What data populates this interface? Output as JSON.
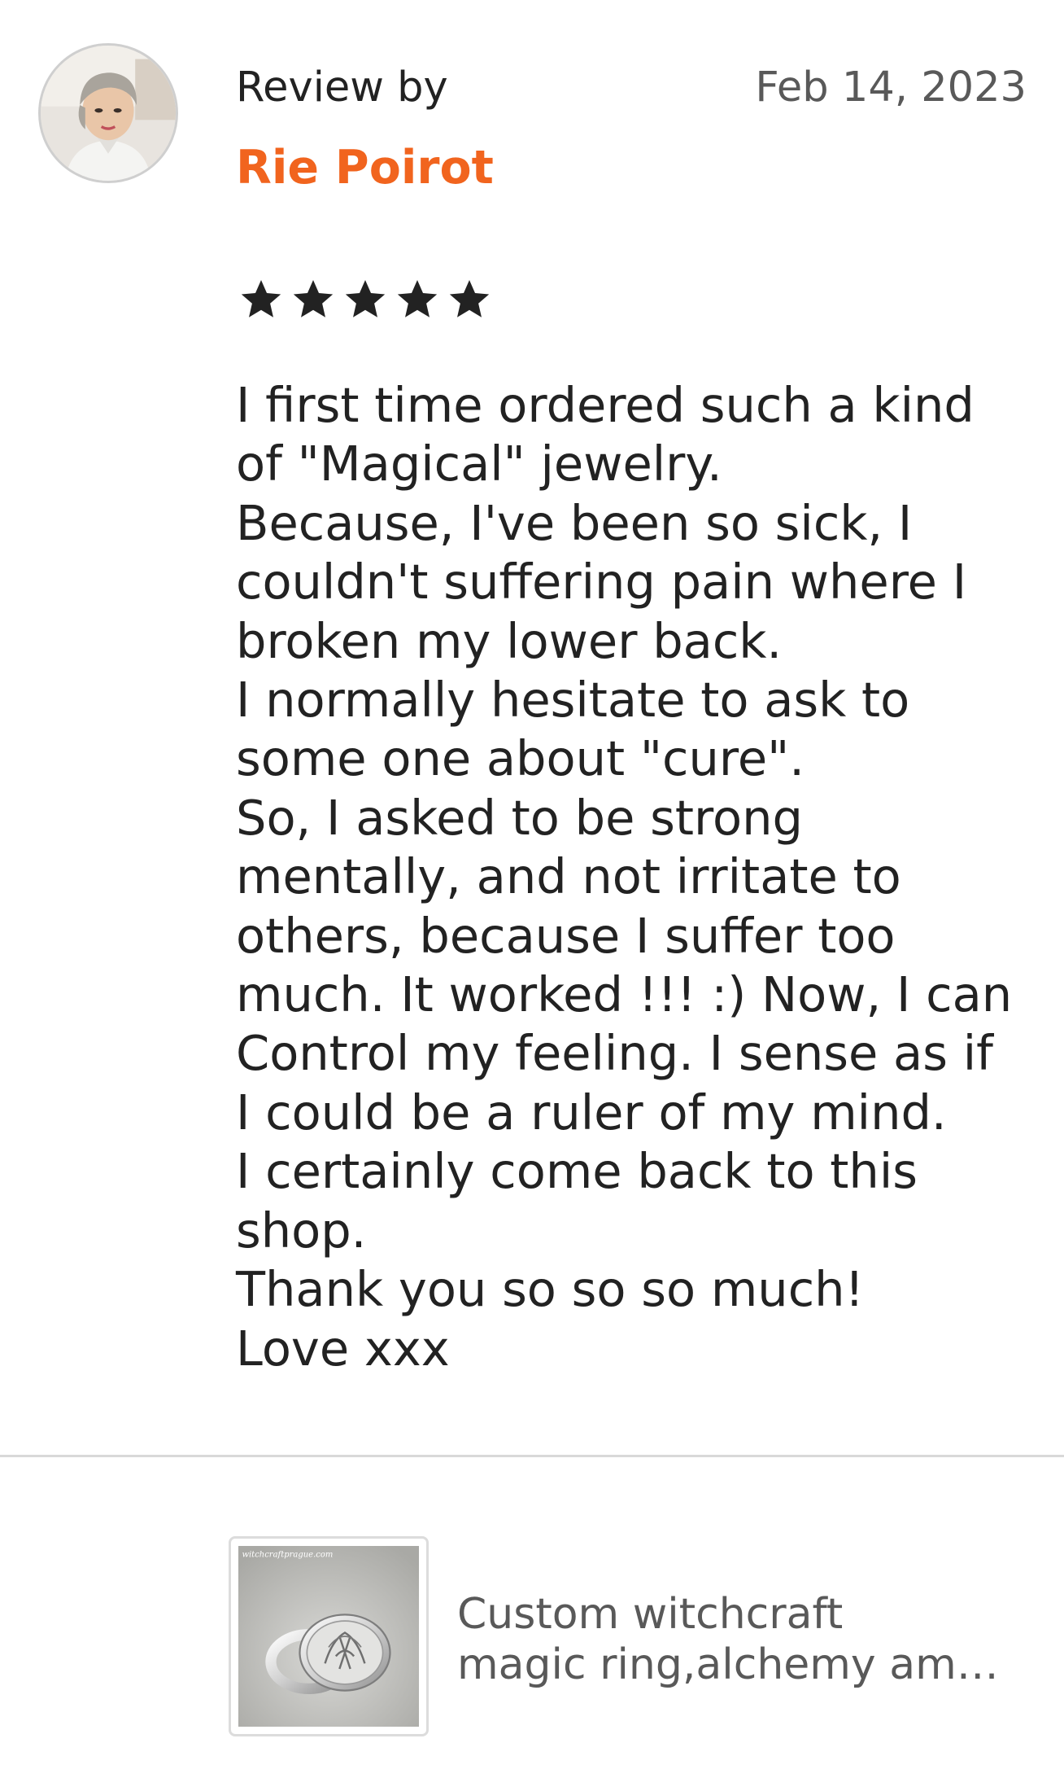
{
  "review": {
    "avatar_icon": "reviewer-avatar",
    "review_by_label": "Review by",
    "date": "Feb 14, 2023",
    "reviewer_name": "Rie Poirot",
    "rating": 5,
    "rating_max": 5,
    "star_icon": "star-icon",
    "text_lines": [
      "I first time ordered such a kind",
      "of \"Magical\" jewelry.",
      "Because, I've been so sick, I",
      "couldn't suffering pain where I",
      "broken my lower back.",
      "I normally hesitate to ask to",
      "some one about \"cure\".",
      "So, I asked to be strong",
      "mentally, and not irritate to",
      "others, because I suffer too",
      "much. It worked !!! :) Now, I can",
      "Control my feeling. I sense as if",
      "I could be a ruler of my mind.",
      "I certainly come back to this",
      "shop.",
      "Thank you so so so much!",
      "Love xxx"
    ]
  },
  "product": {
    "thumbnail_watermark": "witchcraftprague.com",
    "title_lines": [
      "Custom witchcraft",
      "magic ring,alchemy am…"
    ]
  },
  "colors": {
    "accent": "#f1641e",
    "text": "#222222",
    "muted": "#595959",
    "divider": "#d9d9d9"
  }
}
